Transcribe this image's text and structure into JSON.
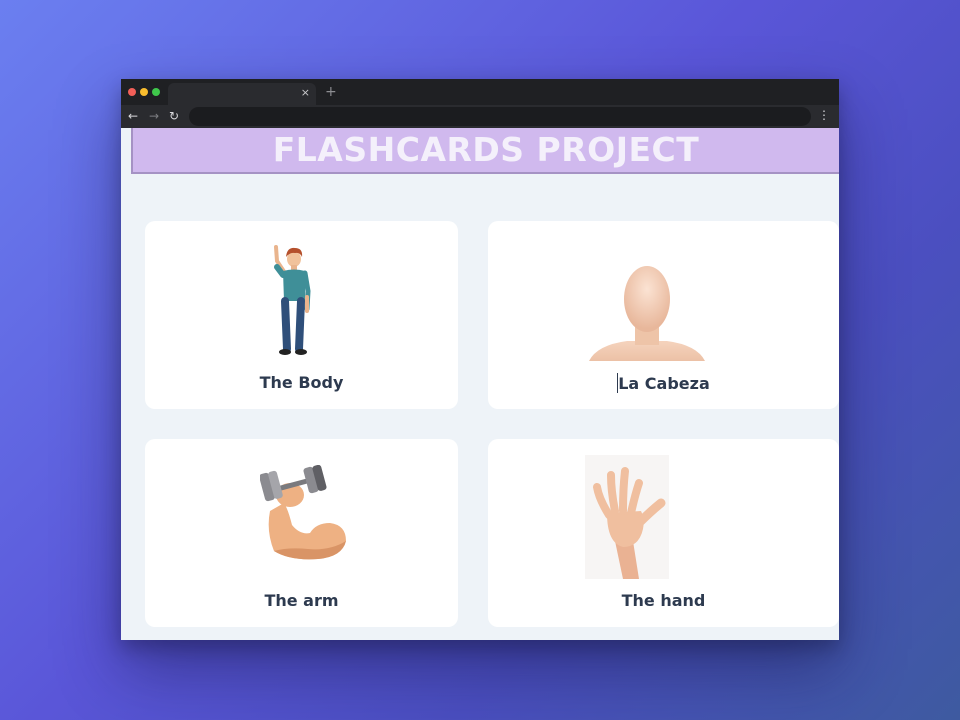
{
  "page": {
    "title": "FLASHCARDS PROJECT"
  },
  "browser": {
    "close_tab_glyph": "×",
    "new_tab_glyph": "+",
    "back_glyph": "←",
    "forward_glyph": "→",
    "reload_glyph": "↻",
    "menu_glyph": "⋮"
  },
  "cards": [
    {
      "label": "The Body",
      "image": "person-standing-illustration"
    },
    {
      "label": "La Cabeza",
      "image": "bald-head-illustration"
    },
    {
      "label": "The arm",
      "image": "flexed-arm-dumbbell-illustration"
    },
    {
      "label": "The hand",
      "image": "open-hand-illustration"
    }
  ],
  "colors": {
    "banner": "#d0b9ee",
    "banner_text": "#f4f0fb",
    "card_text": "#2d3a4f",
    "page_bg": "#eef3f8"
  }
}
